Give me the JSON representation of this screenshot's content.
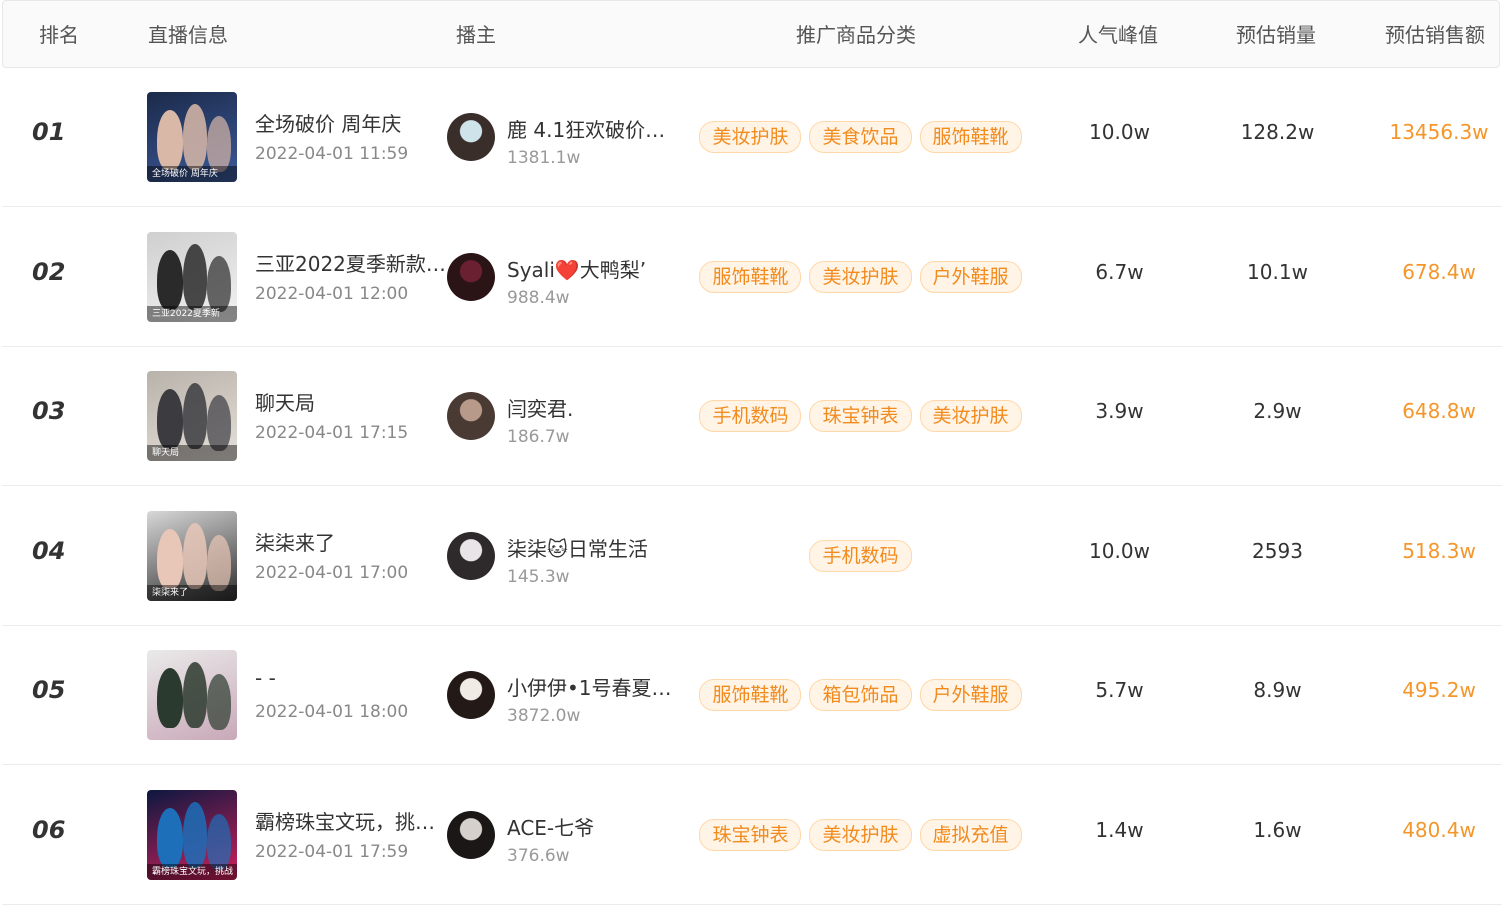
{
  "headers": {
    "rank": "排名",
    "live": "直播信息",
    "host": "播主",
    "category": "推广商品分类",
    "peak": "人气峰值",
    "volume": "预估销量",
    "sales": "预估销售额"
  },
  "rows": [
    {
      "rank": "01",
      "title": "全场破价 周年庆",
      "time": "2022-04-01 11:59",
      "thumb_caption": "全场破价 周年庆",
      "host": "鹿 4.1狂欢破价…",
      "fans": "1381.1w",
      "tags": [
        "美妆护肤",
        "美食饮品",
        "服饰鞋靴"
      ],
      "peak": "10.0w",
      "volume": "128.2w",
      "sales": "13456.3w"
    },
    {
      "rank": "02",
      "title": "三亚2022夏季新款…",
      "time": "2022-04-01 12:00",
      "thumb_caption": "三亚2022夏季新",
      "host": "Syali❤️大鸭梨’",
      "fans": "988.4w",
      "tags": [
        "服饰鞋靴",
        "美妆护肤",
        "户外鞋服"
      ],
      "peak": "6.7w",
      "volume": "10.1w",
      "sales": "678.4w"
    },
    {
      "rank": "03",
      "title": "聊天局",
      "time": "2022-04-01 17:15",
      "thumb_caption": "聊天局",
      "host": "闫奕君.",
      "fans": "186.7w",
      "tags": [
        "手机数码",
        "珠宝钟表",
        "美妆护肤"
      ],
      "peak": "3.9w",
      "volume": "2.9w",
      "sales": "648.8w"
    },
    {
      "rank": "04",
      "title": "柒柒来了",
      "time": "2022-04-01 17:00",
      "thumb_caption": "柒柒来了",
      "host": "柒柒🐱日常生活",
      "fans": "145.3w",
      "tags": [
        "手机数码"
      ],
      "peak": "10.0w",
      "volume": "2593",
      "sales": "518.3w"
    },
    {
      "rank": "05",
      "title": "- -",
      "time": "2022-04-01 18:00",
      "thumb_caption": "",
      "host": "小伊伊•1号春夏…",
      "fans": "3872.0w",
      "tags": [
        "服饰鞋靴",
        "箱包饰品",
        "户外鞋服"
      ],
      "peak": "5.7w",
      "volume": "8.9w",
      "sales": "495.2w"
    },
    {
      "rank": "06",
      "title": "霸榜珠宝文玩，挑…",
      "time": "2022-04-01 17:59",
      "thumb_caption": "霸榜珠宝文玩，挑战",
      "host": "ACE-七爷",
      "fans": "376.6w",
      "tags": [
        "珠宝钟表",
        "美妆护肤",
        "虚拟充值"
      ],
      "peak": "1.4w",
      "volume": "1.6w",
      "sales": "480.4w"
    }
  ],
  "colors": {
    "accent_orange": "#f5962a",
    "tag_bg": "#fff4e6",
    "tag_border": "#ffd7a8",
    "header_bg": "#fafafa"
  }
}
